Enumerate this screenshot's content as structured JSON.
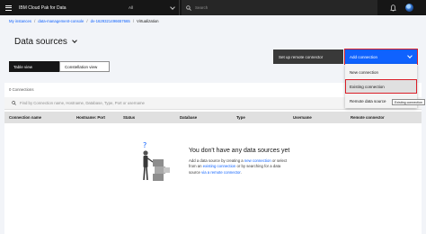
{
  "header": {
    "brand": "IBM Cloud Pak for Data",
    "scope": "All",
    "search_placeholder": "Search"
  },
  "breadcrumb": [
    "My instances",
    "data-management-console",
    "dv-1629321496657665",
    "Virtualization"
  ],
  "page": {
    "title": "Data sources"
  },
  "tabs": [
    "Table view",
    "Constellation view"
  ],
  "toolbar": {
    "remote_label": "Set up remote connector",
    "add_label": "Add connection"
  },
  "menu": {
    "items": [
      "New connection",
      "Existing connection",
      "Remote data source"
    ],
    "tooltip": "Existing connection"
  },
  "table": {
    "count": "0 Connections",
    "filter_placeholder": "Find by Connection name, Hostname, Database, Type, Port or username",
    "columns": [
      "Connection name",
      "Hostname: Port",
      "Status",
      "Database",
      "Type",
      "Username",
      "Remote connector"
    ]
  },
  "empty": {
    "title": "You don't have any data sources yet",
    "p1": "Add a data source by creating a ",
    "l1": "new connection",
    "p2": " or select from an ",
    "l2": "existing connection",
    "p3": " or by searching for a data source ",
    "l3": "via a remote connector",
    "p4": "."
  },
  "colors": {
    "accent": "#0f62fe",
    "header_bg": "#161616",
    "highlight": "#da1e28"
  }
}
